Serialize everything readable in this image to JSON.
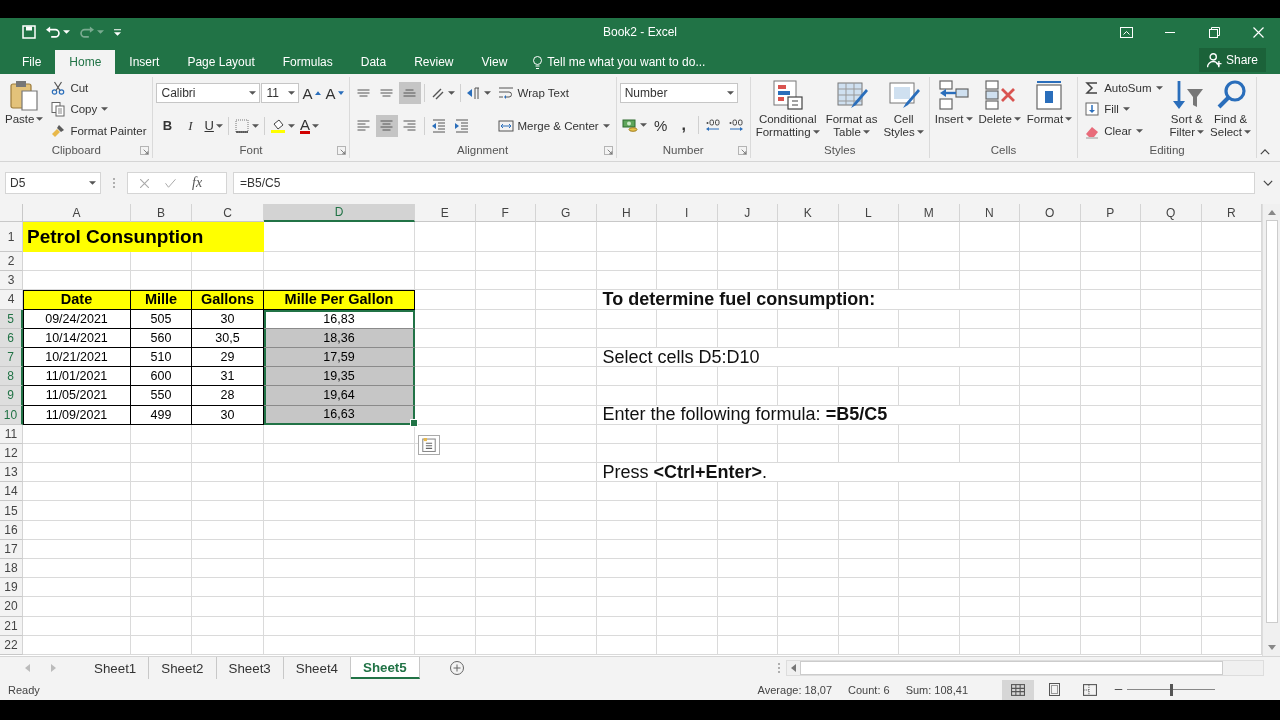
{
  "title_bar": {
    "title": "Book2 - Excel",
    "redo": {
      "disabled": true
    },
    "tell_me": "Tell me what you want to do...",
    "share": "Share"
  },
  "menu_tabs": [
    {
      "label": "File",
      "selected": false
    },
    {
      "label": "Home",
      "selected": true
    },
    {
      "label": "Insert",
      "selected": false
    },
    {
      "label": "Page Layout",
      "selected": false
    },
    {
      "label": "Formulas",
      "selected": false
    },
    {
      "label": "Data",
      "selected": false
    },
    {
      "label": "Review",
      "selected": false
    },
    {
      "label": "View",
      "selected": false
    }
  ],
  "ribbon": {
    "groups": [
      {
        "label": "Clipboard",
        "launcher": true,
        "columns": [
          [
            [
              {
                "kind": "paste",
                "label": "Paste",
                "dropdown": true
              }
            ]
          ],
          [
            [
              {
                "kind": "cut",
                "label": "Cut",
                "dropdown": false
              }
            ],
            [
              {
                "kind": "copy",
                "label": "Copy",
                "dropdown": true
              }
            ],
            [
              {
                "kind": "format-painter",
                "label": "Format Painter",
                "dropdown": false
              }
            ]
          ]
        ]
      },
      {
        "label": "Font",
        "launcher": true,
        "columns": [
          [
            [
              {
                "kind": "font-name",
                "value": "Calibri"
              },
              {
                "kind": "font-size",
                "value": "11"
              },
              {
                "kind": "grow-font",
                "text": "A"
              },
              {
                "kind": "shrink-font",
                "text": "A"
              }
            ],
            [
              {
                "kind": "bold",
                "text": "B"
              },
              {
                "kind": "italic",
                "text": "I"
              },
              {
                "kind": "underline",
                "text": "U",
                "dropdown": true
              },
              {
                "kind": "borders",
                "dropdown": true
              },
              {
                "kind": "fill-color",
                "dropdown": true
              },
              {
                "kind": "font-color",
                "text": "A",
                "dropdown": true
              }
            ]
          ]
        ]
      },
      {
        "label": "Alignment",
        "launcher": true,
        "columns": [
          [
            [
              {
                "kind": "align-top",
                "selected": false
              },
              {
                "kind": "align-middle",
                "selected": false
              },
              {
                "kind": "align-bottom",
                "selected": true
              },
              {
                "kind": "orientation",
                "dropdown": true
              },
              {
                "kind": "text-direction",
                "dropdown": true
              }
            ],
            [
              {
                "kind": "align-left",
                "selected": false
              },
              {
                "kind": "align-center",
                "selected": true
              },
              {
                "kind": "align-right",
                "selected": false
              },
              {
                "kind": "decrease-indent"
              },
              {
                "kind": "increase-indent"
              }
            ]
          ],
          [
            [
              {
                "kind": "wrap-text",
                "label": "Wrap Text",
                "dropdown": false
              }
            ],
            [
              {
                "kind": "merge",
                "label": "Merge & Center",
                "dropdown": true
              }
            ]
          ]
        ]
      },
      {
        "label": "Number",
        "launcher": true,
        "columns": [
          [
            [
              {
                "kind": "number-format",
                "value": "Number"
              }
            ],
            [
              {
                "kind": "currency",
                "dropdown": true
              },
              {
                "kind": "percent",
                "text": "%"
              },
              {
                "kind": "comma",
                "text": ","
              },
              {
                "kind": "increase-decimal"
              },
              {
                "kind": "decrease-decimal"
              }
            ]
          ]
        ]
      },
      {
        "label": "Styles",
        "columns": [
          [
            [
              {
                "kind": "conditional-formatting",
                "label": "Conditional\nFormatting",
                "dropdown": true
              }
            ]
          ],
          [
            [
              {
                "kind": "format-as-table",
                "label": "Format as\nTable",
                "dropdown": true
              }
            ]
          ],
          [
            [
              {
                "kind": "cell-styles",
                "label": "Cell\nStyles",
                "dropdown": true
              }
            ]
          ]
        ]
      },
      {
        "label": "Cells",
        "columns": [
          [
            [
              {
                "kind": "insert",
                "label": "Insert",
                "dropdown": true
              }
            ]
          ],
          [
            [
              {
                "kind": "delete",
                "label": "Delete",
                "dropdown": true
              }
            ]
          ],
          [
            [
              {
                "kind": "format",
                "label": "Format",
                "dropdown": true
              }
            ]
          ]
        ]
      },
      {
        "label": "Editing",
        "columns": [
          [
            [
              {
                "kind": "autosum",
                "label": "AutoSum",
                "dropdown": true
              }
            ],
            [
              {
                "kind": "fill",
                "label": "Fill",
                "dropdown": true
              }
            ],
            [
              {
                "kind": "clear",
                "label": "Clear",
                "dropdown": true
              }
            ]
          ],
          [
            [
              {
                "kind": "sort-filter",
                "label": "Sort &\nFilter",
                "dropdown": true
              }
            ]
          ],
          [
            [
              {
                "kind": "find-select",
                "label": "Find &\nSelect",
                "dropdown": true
              }
            ]
          ]
        ]
      }
    ]
  },
  "formula_bar": {
    "name_box": "D5",
    "function_label": "fx",
    "formula": "=B5/C5"
  },
  "sheet": {
    "columns": [
      {
        "label": "A",
        "selected": false
      },
      {
        "label": "B",
        "selected": false
      },
      {
        "label": "C",
        "selected": false
      },
      {
        "label": "D",
        "selected": true
      },
      {
        "label": "E",
        "selected": false
      },
      {
        "label": "F",
        "selected": false
      },
      {
        "label": "G",
        "selected": false
      },
      {
        "label": "H",
        "selected": false
      },
      {
        "label": "I",
        "selected": false
      },
      {
        "label": "J",
        "selected": false
      },
      {
        "label": "K",
        "selected": false
      },
      {
        "label": "L",
        "selected": false
      },
      {
        "label": "M",
        "selected": false
      },
      {
        "label": "N",
        "selected": false
      },
      {
        "label": "O",
        "selected": false
      },
      {
        "label": "P",
        "selected": false
      },
      {
        "label": "Q",
        "selected": false
      },
      {
        "label": "R",
        "selected": false
      }
    ],
    "rows": [
      {
        "label": "1",
        "selected": false,
        "kind": "title",
        "cells": [
          {
            "text": "Petrol Consunption",
            "selected": false,
            "active": false
          }
        ]
      },
      {
        "label": "2",
        "selected": false,
        "kind": "blank"
      },
      {
        "label": "3",
        "selected": false,
        "kind": "blank"
      },
      {
        "label": "4",
        "selected": false,
        "kind": "header",
        "cells": [
          {
            "text": "Date",
            "selected": false,
            "active": false
          },
          {
            "text": "Mille",
            "selected": false,
            "active": false
          },
          {
            "text": "Gallons",
            "selected": false,
            "active": false
          },
          {
            "text": "Mille Per Gallon",
            "selected": false,
            "active": false
          }
        ],
        "note": {
          "kind": "heading",
          "text": "To determine fuel consumption:"
        }
      },
      {
        "label": "5",
        "selected": true,
        "kind": "data",
        "cells": [
          {
            "text": "09/24/2021",
            "selected": false,
            "active": false
          },
          {
            "text": "505",
            "selected": false,
            "active": false
          },
          {
            "text": "30",
            "selected": false,
            "active": false
          },
          {
            "text": "16,83",
            "selected": true,
            "active": true
          }
        ]
      },
      {
        "label": "6",
        "selected": true,
        "kind": "data",
        "cells": [
          {
            "text": "10/14/2021",
            "selected": false,
            "active": false
          },
          {
            "text": "560",
            "selected": false,
            "active": false
          },
          {
            "text": "30,5",
            "selected": false,
            "active": false
          },
          {
            "text": "18,36",
            "selected": true,
            "active": false
          }
        ]
      },
      {
        "label": "7",
        "selected": true,
        "kind": "data",
        "cells": [
          {
            "text": "10/21/2021",
            "selected": false,
            "active": false
          },
          {
            "text": "510",
            "selected": false,
            "active": false
          },
          {
            "text": "29",
            "selected": false,
            "active": false
          },
          {
            "text": "17,59",
            "selected": true,
            "active": false
          }
        ],
        "note": {
          "kind": "text",
          "text": "Select cells D5:D10"
        }
      },
      {
        "label": "8",
        "selected": true,
        "kind": "data",
        "cells": [
          {
            "text": "11/01/2021",
            "selected": false,
            "active": false
          },
          {
            "text": "600",
            "selected": false,
            "active": false
          },
          {
            "text": "31",
            "selected": false,
            "active": false
          },
          {
            "text": "19,35",
            "selected": true,
            "active": false
          }
        ]
      },
      {
        "label": "9",
        "selected": true,
        "kind": "data",
        "cells": [
          {
            "text": "11/05/2021",
            "selected": false,
            "active": false
          },
          {
            "text": "550",
            "selected": false,
            "active": false
          },
          {
            "text": "28",
            "selected": false,
            "active": false
          },
          {
            "text": "19,64",
            "selected": true,
            "active": false
          }
        ]
      },
      {
        "label": "10",
        "selected": true,
        "kind": "data",
        "cells": [
          {
            "text": "11/09/2021",
            "selected": false,
            "active": false
          },
          {
            "text": "499",
            "selected": false,
            "active": false
          },
          {
            "text": "30",
            "selected": false,
            "active": false
          },
          {
            "text": "16,63",
            "selected": true,
            "active": false
          }
        ],
        "note": {
          "kind": "text",
          "text": "Enter the following formula: **=B5/C5**"
        }
      },
      {
        "label": "11",
        "selected": false,
        "kind": "blank"
      },
      {
        "label": "12",
        "selected": false,
        "kind": "blank"
      },
      {
        "label": "13",
        "selected": false,
        "kind": "blank",
        "note": {
          "kind": "text",
          "text": "Press **<Ctrl+Enter>**."
        }
      },
      {
        "label": "14",
        "selected": false,
        "kind": "blank"
      },
      {
        "label": "15",
        "selected": false,
        "kind": "blank"
      },
      {
        "label": "16",
        "selected": false,
        "kind": "blank"
      },
      {
        "label": "17",
        "selected": false,
        "kind": "blank"
      },
      {
        "label": "18",
        "selected": false,
        "kind": "blank"
      },
      {
        "label": "19",
        "selected": false,
        "kind": "blank"
      },
      {
        "label": "20",
        "selected": false,
        "kind": "blank"
      },
      {
        "label": "21",
        "selected": false,
        "kind": "blank"
      },
      {
        "label": "22",
        "selected": false,
        "kind": "blank"
      }
    ]
  },
  "sheet_tabs": [
    {
      "label": "Sheet1",
      "selected": false
    },
    {
      "label": "Sheet2",
      "selected": false
    },
    {
      "label": "Sheet3",
      "selected": false
    },
    {
      "label": "Sheet4",
      "selected": false
    },
    {
      "label": "Sheet5",
      "selected": true
    }
  ],
  "status_bar": {
    "mode": "Ready",
    "average": "Average: 18,07",
    "count": "Count: 6",
    "sum": "Sum: 108,41",
    "views": [
      {
        "kind": "normal",
        "selected": true
      },
      {
        "kind": "page-layout",
        "selected": false
      },
      {
        "kind": "page-break",
        "selected": false
      }
    ],
    "zoom": {
      "level": 0.5
    }
  }
}
